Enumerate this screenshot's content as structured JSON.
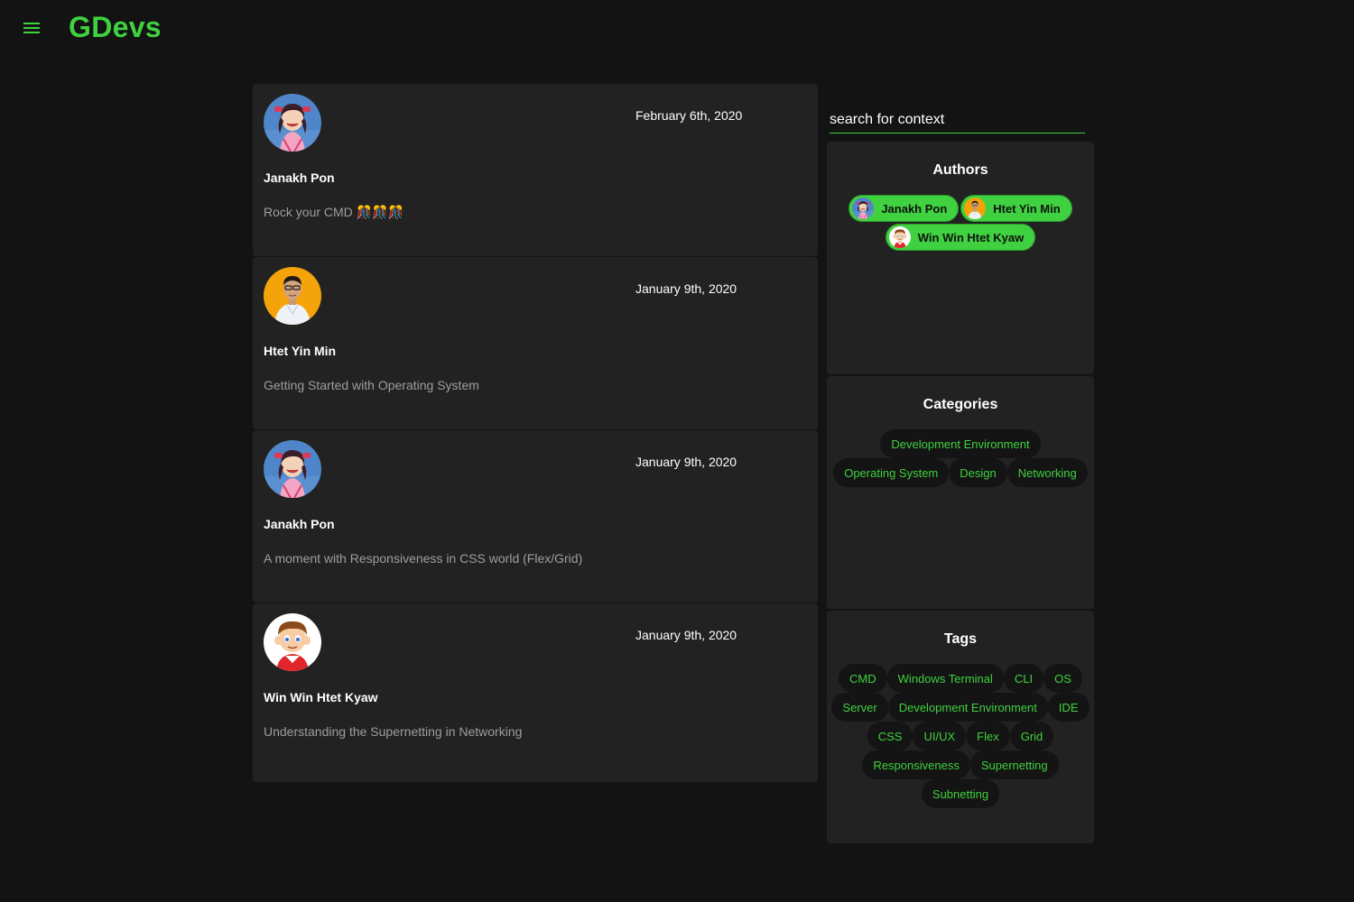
{
  "app": {
    "brand": "GDevs"
  },
  "search": {
    "placeholder": "search for context",
    "value": ""
  },
  "posts": [
    {
      "author": "Janakh Pon",
      "date": "February 6th, 2020",
      "title": "Rock your CMD 🎊🎊🎊",
      "avatar": "anime-girl-avatar"
    },
    {
      "author": "Htet Yin Min",
      "date": "January 9th, 2020",
      "title": "Getting Started with Operating System",
      "avatar": "man-photo-avatar"
    },
    {
      "author": "Janakh Pon",
      "date": "January 9th, 2020",
      "title": "A moment with Responsiveness in CSS world (Flex/Grid)",
      "avatar": "anime-girl-avatar"
    },
    {
      "author": "Win Win Htet Kyaw",
      "date": "January 9th, 2020",
      "title": "Understanding the Supernetting in Networking",
      "avatar": "cartoon-boy-avatar"
    }
  ],
  "sidebar": {
    "authors": {
      "heading": "Authors",
      "items": [
        "Janakh Pon",
        "Htet Yin Min",
        "Win Win Htet Kyaw"
      ]
    },
    "categories": {
      "heading": "Categories",
      "items": [
        "Development Environment",
        "Operating System",
        "Design",
        "Networking"
      ]
    },
    "tags": {
      "heading": "Tags",
      "items": [
        "CMD",
        "Windows Terminal",
        "CLI",
        "OS",
        "Server",
        "Development Environment",
        "IDE",
        "CSS",
        "UI/UX",
        "Flex",
        "Grid",
        "Responsiveness",
        "Supernetting",
        "Subnetting"
      ]
    }
  },
  "colors": {
    "accent": "#3fd13f",
    "background": "#131313",
    "card": "#222222"
  }
}
